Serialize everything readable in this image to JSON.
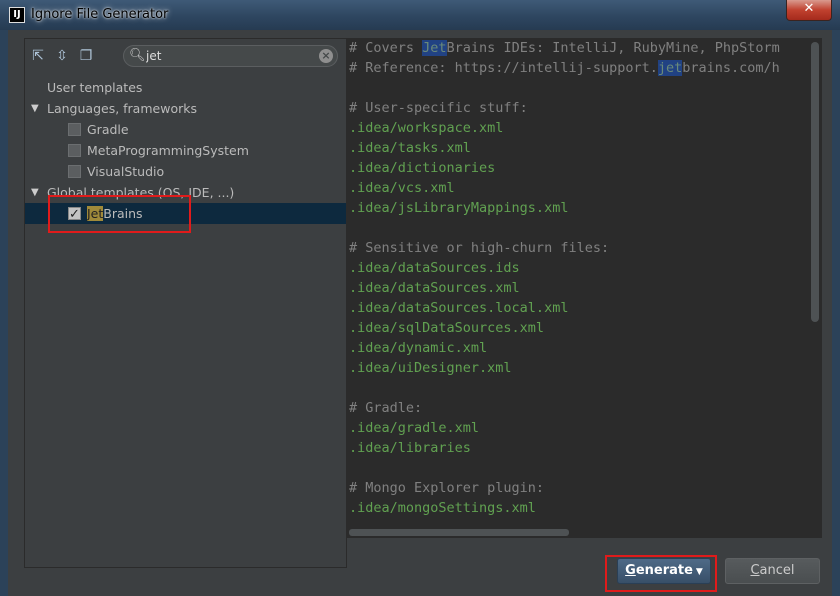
{
  "window": {
    "title": "Ignore File Generator",
    "app_icon": "IJ"
  },
  "search": {
    "value": "jet"
  },
  "tree": [
    {
      "label": "User templates",
      "type": "group"
    },
    {
      "label": "Languages, frameworks",
      "type": "group",
      "expanded": true
    },
    {
      "label": "Gradle",
      "type": "item",
      "checked": false
    },
    {
      "label": "MetaProgrammingSystem",
      "type": "item",
      "checked": false
    },
    {
      "label": "VisualStudio",
      "type": "item",
      "checked": false
    },
    {
      "label": "Global templates (OS, IDE, ...)",
      "type": "group",
      "expanded": true
    },
    {
      "label": "JetBrains",
      "type": "item",
      "checked": true,
      "selected": true,
      "match": "Jet",
      "rest": "Brains"
    }
  ],
  "editor": {
    "lines": [
      {
        "kind": "comment",
        "pre": "# Covers ",
        "match": "Jet",
        "post": "Brains IDEs: IntelliJ, RubyMine, PhpStorm"
      },
      {
        "kind": "comment",
        "pre": "# Reference: https://intellij-support.",
        "match": "jet",
        "post": "brains.com/h"
      },
      {
        "kind": "blank",
        "text": ""
      },
      {
        "kind": "comment",
        "text": "# User-specific stuff:"
      },
      {
        "kind": "path",
        "text": ".idea/workspace.xml"
      },
      {
        "kind": "path",
        "text": ".idea/tasks.xml"
      },
      {
        "kind": "path",
        "text": ".idea/dictionaries"
      },
      {
        "kind": "path",
        "text": ".idea/vcs.xml"
      },
      {
        "kind": "path",
        "text": ".idea/jsLibraryMappings.xml"
      },
      {
        "kind": "blank",
        "text": ""
      },
      {
        "kind": "comment",
        "text": "# Sensitive or high-churn files:"
      },
      {
        "kind": "path",
        "text": ".idea/dataSources.ids"
      },
      {
        "kind": "path",
        "text": ".idea/dataSources.xml"
      },
      {
        "kind": "path",
        "text": ".idea/dataSources.local.xml"
      },
      {
        "kind": "path",
        "text": ".idea/sqlDataSources.xml"
      },
      {
        "kind": "path",
        "text": ".idea/dynamic.xml"
      },
      {
        "kind": "path",
        "text": ".idea/uiDesigner.xml"
      },
      {
        "kind": "blank",
        "text": ""
      },
      {
        "kind": "comment",
        "text": "# Gradle:"
      },
      {
        "kind": "path",
        "text": ".idea/gradle.xml"
      },
      {
        "kind": "path",
        "text": ".idea/libraries"
      },
      {
        "kind": "blank",
        "text": ""
      },
      {
        "kind": "comment",
        "text": "# Mongo Explorer plugin:"
      },
      {
        "kind": "path",
        "text": ".idea/mongoSettings.xml"
      }
    ]
  },
  "buttons": {
    "generate": {
      "label": "Generate",
      "mnemonic_first": "G",
      "rest": "enerate"
    },
    "cancel": {
      "label": "Cancel",
      "mnemonic_first": "C",
      "rest": "ancel"
    }
  },
  "icons": {
    "expand_all": "expand-all-icon",
    "collapse_all": "collapse-all-icon",
    "unselect_all": "unselect-all-icon",
    "search": "search-icon",
    "clear": "clear-icon",
    "close": "close-icon"
  }
}
